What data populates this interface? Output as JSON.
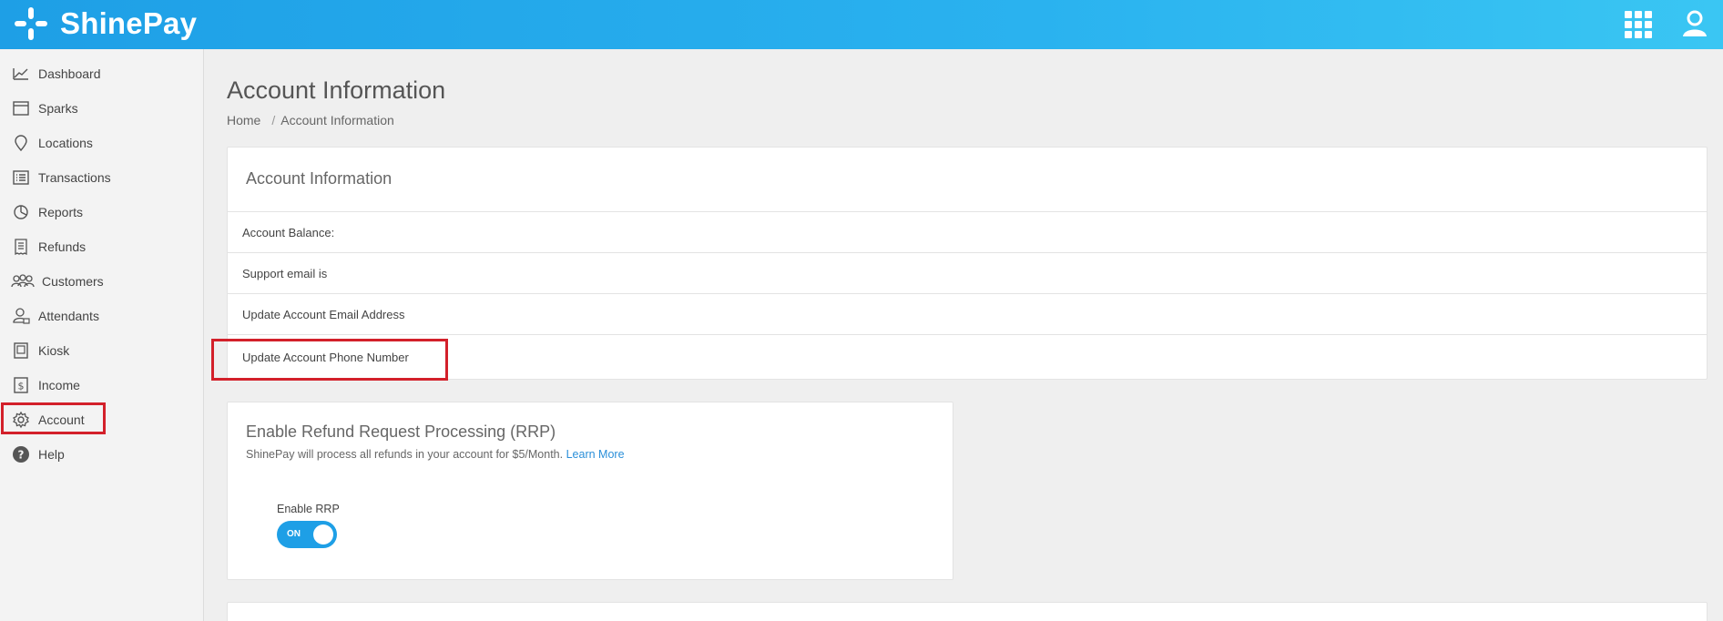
{
  "app": {
    "name": "ShinePay"
  },
  "sidebar": {
    "items": [
      {
        "label": "Dashboard",
        "icon": "dashboard-chart-icon"
      },
      {
        "label": "Sparks",
        "icon": "calendar-icon"
      },
      {
        "label": "Locations",
        "icon": "location-pin-icon"
      },
      {
        "label": "Transactions",
        "icon": "list-icon"
      },
      {
        "label": "Reports",
        "icon": "pie-chart-icon"
      },
      {
        "label": "Refunds",
        "icon": "receipt-icon"
      },
      {
        "label": "Customers",
        "icon": "customers-icon"
      },
      {
        "label": "Attendants",
        "icon": "attendant-icon"
      },
      {
        "label": "Kiosk",
        "icon": "kiosk-icon"
      },
      {
        "label": "Income",
        "icon": "dollar-icon"
      },
      {
        "label": "Account",
        "icon": "gear-icon"
      },
      {
        "label": "Help",
        "icon": "help-icon"
      }
    ],
    "active": "Account"
  },
  "page": {
    "title": "Account Information",
    "breadcrumb": {
      "home": "Home",
      "separator": "/",
      "current": "Account Information"
    }
  },
  "account_card": {
    "title": "Account Information",
    "rows": [
      "Account Balance:",
      "Support email is",
      "Update Account Email Address",
      "Update Account Phone Number"
    ]
  },
  "rrp_card": {
    "title": "Enable Refund Request Processing (RRP)",
    "description": "ShinePay will process all refunds in your account for $5/Month.",
    "learn_more": "Learn More",
    "toggle_label": "Enable RRP",
    "toggle_state": "ON"
  },
  "colors": {
    "brand": "#1e9fe6",
    "highlight": "#d3202a",
    "link": "#2a8fd9"
  }
}
